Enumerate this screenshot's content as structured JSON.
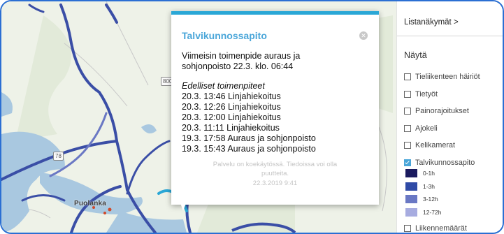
{
  "popup": {
    "title": "Talvikunnossapito",
    "close_icon": "close-icon",
    "latest_line1": "Viimeisin toimenpide auraus ja",
    "latest_line2": "sohjonpoisto 22.3. klo. 06:44",
    "previous_heading": "Edelliset toimenpiteet",
    "previous": [
      "20.3. 13:46 Linjahiekoitus",
      "20.3. 12:26 Linjahiekoitus",
      "20.3. 12:00 Linjahiekoitus",
      "20.3. 11:11 Linjahiekoitus",
      "19.3. 17:58 Auraus ja sohjonpoisto",
      "19.3. 15:43 Auraus ja sohjonpoisto"
    ],
    "notice_line1": "Palvelu on koekäytössä. Tiedoissa voi olla",
    "notice_line2": "puutteita.",
    "timestamp": "22.3.2019 9:41"
  },
  "map": {
    "place_label": "Puolanka",
    "road_numbers": [
      "800",
      "78"
    ]
  },
  "panel": {
    "list_views_label": "Listanäkymät >",
    "show_heading": "Näytä",
    "layers": [
      {
        "label": "Tieliikenteen häiriöt",
        "checked": false
      },
      {
        "label": "Tietyöt",
        "checked": false
      },
      {
        "label": "Painorajoitukset",
        "checked": false
      },
      {
        "label": "Ajokeli",
        "checked": false
      },
      {
        "label": "Kelikamerat",
        "checked": false
      },
      {
        "label": "Talvikunnossapito",
        "checked": true
      }
    ],
    "legend": [
      {
        "label": "0-1h",
        "color": "#1a1a5e"
      },
      {
        "label": "1-3h",
        "color": "#2f4aa6"
      },
      {
        "label": "3-12h",
        "color": "#6a78c4"
      },
      {
        "label": "12-72h",
        "color": "#a7ace0"
      }
    ],
    "last_layer": {
      "label": "Liikennemäärät",
      "checked": false
    }
  },
  "colors": {
    "accent": "#4aa6d9",
    "frame": "#2b6fd3",
    "popup_top": "#2aa7d6",
    "lake": "#a9c8e0",
    "land": "#eef2e8"
  }
}
